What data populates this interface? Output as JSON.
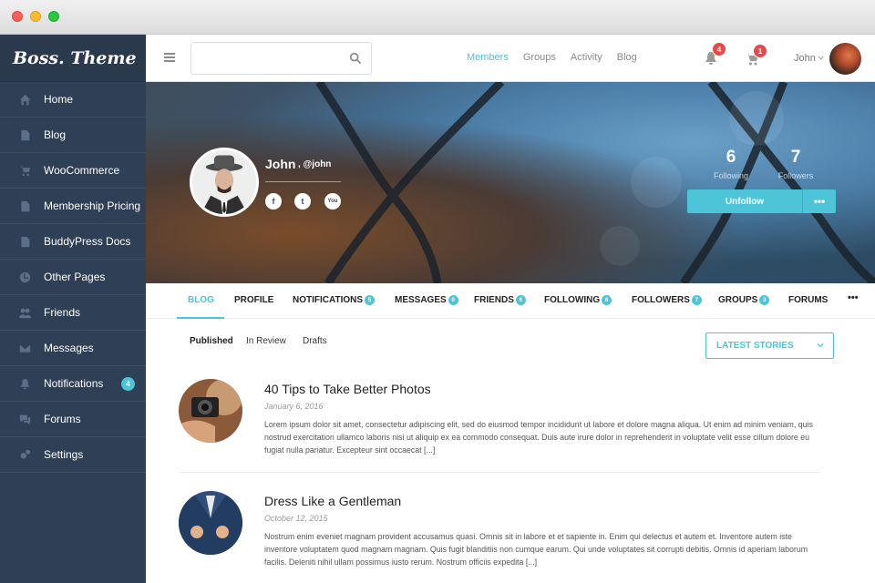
{
  "brand": {
    "logo_text": "Boss. Theme"
  },
  "sidebar": {
    "items": [
      {
        "label": "Home",
        "icon": "home-icon"
      },
      {
        "label": "Blog",
        "icon": "document-icon"
      },
      {
        "label": "WooCommerce",
        "icon": "cart-icon"
      },
      {
        "label": "Membership Pricing",
        "icon": "document-icon"
      },
      {
        "label": "BuddyPress Docs",
        "icon": "document-icon"
      },
      {
        "label": "Other Pages",
        "icon": "clock-icon"
      },
      {
        "label": "Friends",
        "icon": "users-icon"
      },
      {
        "label": "Messages",
        "icon": "envelope-icon"
      },
      {
        "label": "Notifications",
        "icon": "bell-icon",
        "badge": "4"
      },
      {
        "label": "Forums",
        "icon": "chat-icon"
      },
      {
        "label": "Settings",
        "icon": "gears-icon"
      }
    ]
  },
  "topbar": {
    "search": {
      "placeholder": "",
      "value": ""
    },
    "nav": [
      "Members",
      "Groups",
      "Activity",
      "Blog"
    ],
    "active_nav": "Members",
    "notifications_count": "4",
    "cart_count": "1",
    "user_name": "John"
  },
  "profile": {
    "name": "John",
    "handle": ", @john",
    "social": {
      "facebook": "f",
      "twitter": "t",
      "youtube": "You"
    },
    "following_count": "6",
    "following_label": "Following",
    "followers_count": "7",
    "followers_label": "Followers",
    "unfollow_label": "Unfollow",
    "more_label": "•••"
  },
  "profile_tabs": [
    {
      "label": "BLOG",
      "count": ""
    },
    {
      "label": "PROFILE",
      "count": ""
    },
    {
      "label": "NOTIFICATIONS",
      "count": "5"
    },
    {
      "label": "MESSAGES",
      "count": "0"
    },
    {
      "label": "FRIENDS",
      "count": "6"
    },
    {
      "label": "FOLLOWING",
      "count": "6"
    },
    {
      "label": "FOLLOWERS",
      "count": "7"
    },
    {
      "label": "GROUPS",
      "count": "3"
    },
    {
      "label": "FORUMS",
      "count": ""
    }
  ],
  "profile_tabs_more": "•••",
  "sub_tabs": [
    "Published",
    "In Review",
    "Drafts"
  ],
  "sort_select": {
    "selected": "LATEST STORIES"
  },
  "posts": [
    {
      "title": "40 Tips to Take Better Photos",
      "date": "January 6, 2016",
      "excerpt": "Lorem ipsum dolor sit amet, consectetur adipiscing elit, sed do eiusmod tempor incididunt ut labore et dolore magna aliqua. Ut enim ad minim veniam, quis nostrud exercitation ullamco laboris nisi ut aliquip ex ea commodo consequat. Duis aute irure dolor in reprehenderit in voluptate velit esse cillum dolore eu fugiat nulla pariatur. Excepteur sint occaecat [...]"
    },
    {
      "title": "Dress Like a Gentleman",
      "date": "October 12, 2015",
      "excerpt": "Nostrum enim eveniet magnam provident accusamus quasi. Omnis sit in labore et et sapiente in. Enim qui delectus et autem et. Inventore autem iste inventore voluptatem quod magnam magnam. Quis fugit blanditiis non cumque earum. Qui unde voluptates sit corrupti debitis. Omnis id aperiam laborum facilis. Deleniti nihil ullam possimus iusto rerum. Nostrum officiis expedita [...]"
    }
  ],
  "colors": {
    "accent": "#4dc4d8",
    "sidebar_bg": "#2f3f55",
    "badge_red": "#e64a4a"
  }
}
